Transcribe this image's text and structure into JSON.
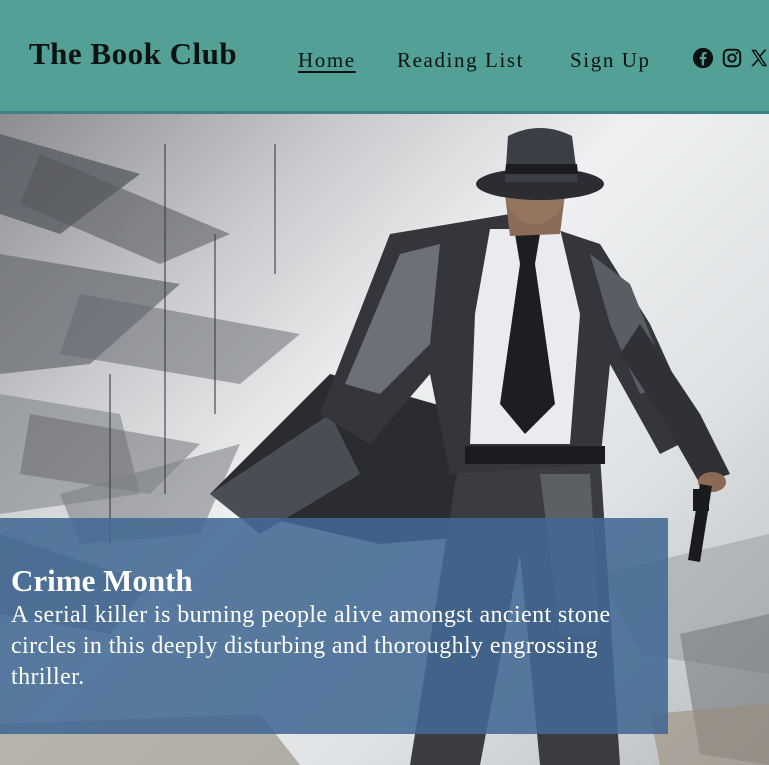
{
  "header": {
    "site_title": "The Book Club",
    "nav": {
      "home": "Home",
      "reading_list": "Reading List",
      "sign_up": "Sign Up"
    },
    "social_icons": [
      "facebook-icon",
      "instagram-icon",
      "x-icon"
    ],
    "background_color": "#52a096"
  },
  "hero": {
    "image": "noir-detective-illustration",
    "feature_title": "Crime Month",
    "feature_text": "A serial killer is burning people alive amongst ancient stone circles in this deeply disturbing and thoroughly engrossing thriller.",
    "panel_color": "#426993"
  }
}
